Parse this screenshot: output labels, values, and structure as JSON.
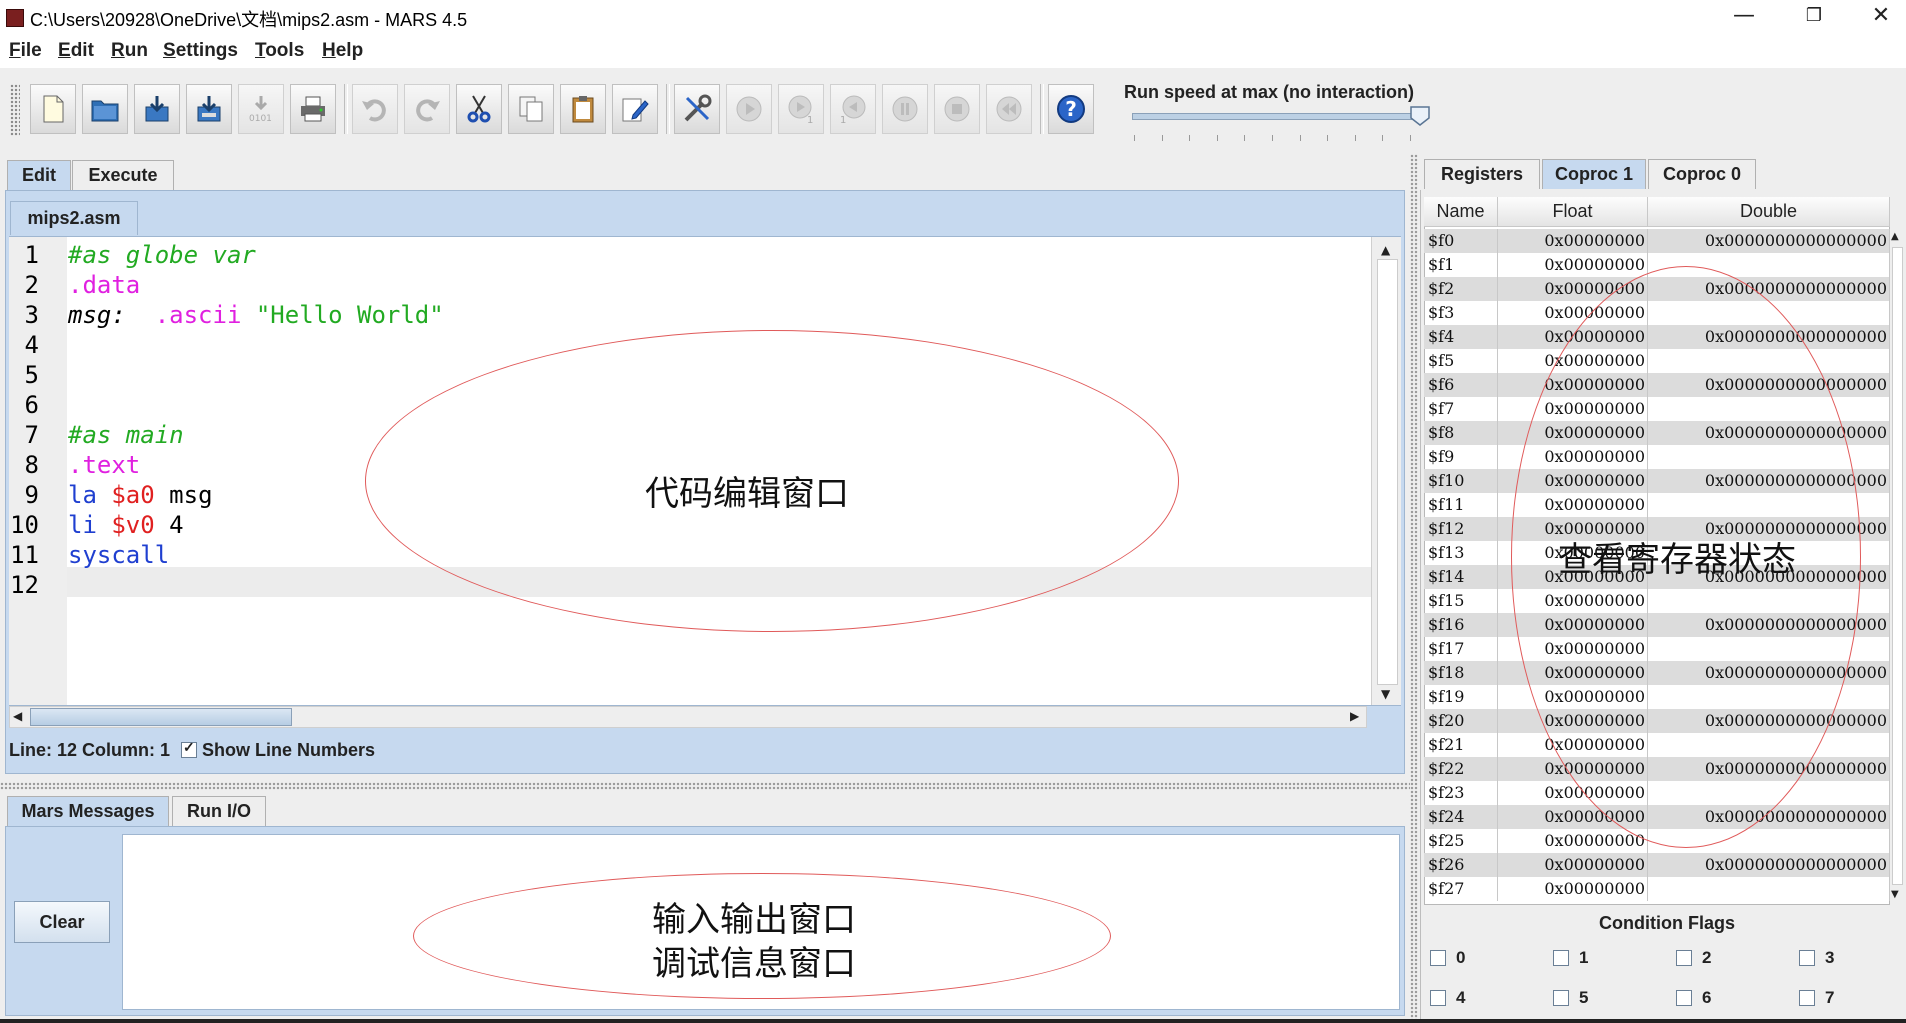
{
  "window": {
    "title": "C:\\Users\\20928\\OneDrive\\文档\\mips2.asm  - MARS 4.5",
    "minimize": "—",
    "maximize": "❐",
    "close": "✕"
  },
  "menu": [
    "File",
    "Edit",
    "Run",
    "Settings",
    "Tools",
    "Help"
  ],
  "toolbar": {
    "run_speed_label": "Run speed at max (no interaction)",
    "run_speed_level": 1.0
  },
  "main_tabs": [
    {
      "label": "Edit",
      "selected": true
    },
    {
      "label": "Execute",
      "selected": false
    }
  ],
  "file_tab": "mips2.asm",
  "editor": {
    "lines": [
      {
        "n": "1",
        "parts": [
          {
            "t": "#as globe var",
            "c": "comment"
          }
        ]
      },
      {
        "n": "2",
        "parts": [
          {
            "t": ".data",
            "c": "directive"
          }
        ]
      },
      {
        "n": "3",
        "parts": [
          {
            "t": "msg:  ",
            "c": "label"
          },
          {
            "t": ".ascii",
            "c": "directive"
          },
          {
            "t": " ",
            "c": "plain"
          },
          {
            "t": "\"Hello World\"",
            "c": "string"
          }
        ]
      },
      {
        "n": "4",
        "parts": []
      },
      {
        "n": "5",
        "parts": []
      },
      {
        "n": "6",
        "parts": []
      },
      {
        "n": "7",
        "parts": [
          {
            "t": "#as main",
            "c": "comment"
          }
        ]
      },
      {
        "n": "8",
        "parts": [
          {
            "t": ".text",
            "c": "directive"
          }
        ]
      },
      {
        "n": "9",
        "parts": [
          {
            "t": "la",
            "c": "instr"
          },
          {
            "t": " ",
            "c": "plain"
          },
          {
            "t": "$a0",
            "c": "register"
          },
          {
            "t": " msg",
            "c": "plain"
          }
        ]
      },
      {
        "n": "10",
        "parts": [
          {
            "t": "li",
            "c": "instr"
          },
          {
            "t": " ",
            "c": "plain"
          },
          {
            "t": "$v0",
            "c": "register"
          },
          {
            "t": " 4",
            "c": "plain"
          }
        ]
      },
      {
        "n": "11",
        "parts": [
          {
            "t": "syscall",
            "c": "instr"
          }
        ]
      },
      {
        "n": "12",
        "parts": []
      }
    ]
  },
  "status": {
    "line_col": "Line: 12 Column: 1",
    "show_line_numbers": "Show Line Numbers",
    "show_line_numbers_checked": true
  },
  "message_tabs": [
    {
      "label": "Mars Messages",
      "selected": true
    },
    {
      "label": "Run I/O",
      "selected": false
    }
  ],
  "clear_label": "Clear",
  "register_tabs": [
    {
      "label": "Registers",
      "selected": false
    },
    {
      "label": "Coproc 1",
      "selected": true
    },
    {
      "label": "Coproc 0",
      "selected": false
    }
  ],
  "register_table": {
    "headers": [
      "Name",
      "Float",
      "Double"
    ],
    "rows": [
      [
        "$f0",
        "0x00000000",
        "0x0000000000000000"
      ],
      [
        "$f1",
        "0x00000000",
        ""
      ],
      [
        "$f2",
        "0x00000000",
        "0x0000000000000000"
      ],
      [
        "$f3",
        "0x00000000",
        ""
      ],
      [
        "$f4",
        "0x00000000",
        "0x0000000000000000"
      ],
      [
        "$f5",
        "0x00000000",
        ""
      ],
      [
        "$f6",
        "0x00000000",
        "0x0000000000000000"
      ],
      [
        "$f7",
        "0x00000000",
        ""
      ],
      [
        "$f8",
        "0x00000000",
        "0x0000000000000000"
      ],
      [
        "$f9",
        "0x00000000",
        ""
      ],
      [
        "$f10",
        "0x00000000",
        "0x0000000000000000"
      ],
      [
        "$f11",
        "0x00000000",
        ""
      ],
      [
        "$f12",
        "0x00000000",
        "0x0000000000000000"
      ],
      [
        "$f13",
        "0x00000000",
        ""
      ],
      [
        "$f14",
        "0x00000000",
        "0x0000000000000000"
      ],
      [
        "$f15",
        "0x00000000",
        ""
      ],
      [
        "$f16",
        "0x00000000",
        "0x0000000000000000"
      ],
      [
        "$f17",
        "0x00000000",
        ""
      ],
      [
        "$f18",
        "0x00000000",
        "0x0000000000000000"
      ],
      [
        "$f19",
        "0x00000000",
        ""
      ],
      [
        "$f20",
        "0x00000000",
        "0x0000000000000000"
      ],
      [
        "$f21",
        "0x00000000",
        ""
      ],
      [
        "$f22",
        "0x00000000",
        "0x0000000000000000"
      ],
      [
        "$f23",
        "0x00000000",
        ""
      ],
      [
        "$f24",
        "0x00000000",
        "0x0000000000000000"
      ],
      [
        "$f25",
        "0x00000000",
        ""
      ],
      [
        "$f26",
        "0x00000000",
        "0x0000000000000000"
      ],
      [
        "$f27",
        "0x00000000",
        ""
      ]
    ]
  },
  "condition_flags": {
    "title": "Condition Flags",
    "flags": [
      "0",
      "1",
      "2",
      "3",
      "4",
      "5",
      "6",
      "7"
    ]
  },
  "annotations": {
    "editor": "代码编辑窗口",
    "registers": "查看寄存器状态",
    "io_line1": "输入输出窗口",
    "io_line2": "调试信息窗口"
  },
  "colors": {
    "comment": "#22aa22",
    "directive": "#e020e0",
    "label": "#000000",
    "string": "#22aa22",
    "instr": "#1f3fd0",
    "register": "#e02020",
    "plain": "#000000",
    "annotation_ellipse": "#e05a5a"
  }
}
